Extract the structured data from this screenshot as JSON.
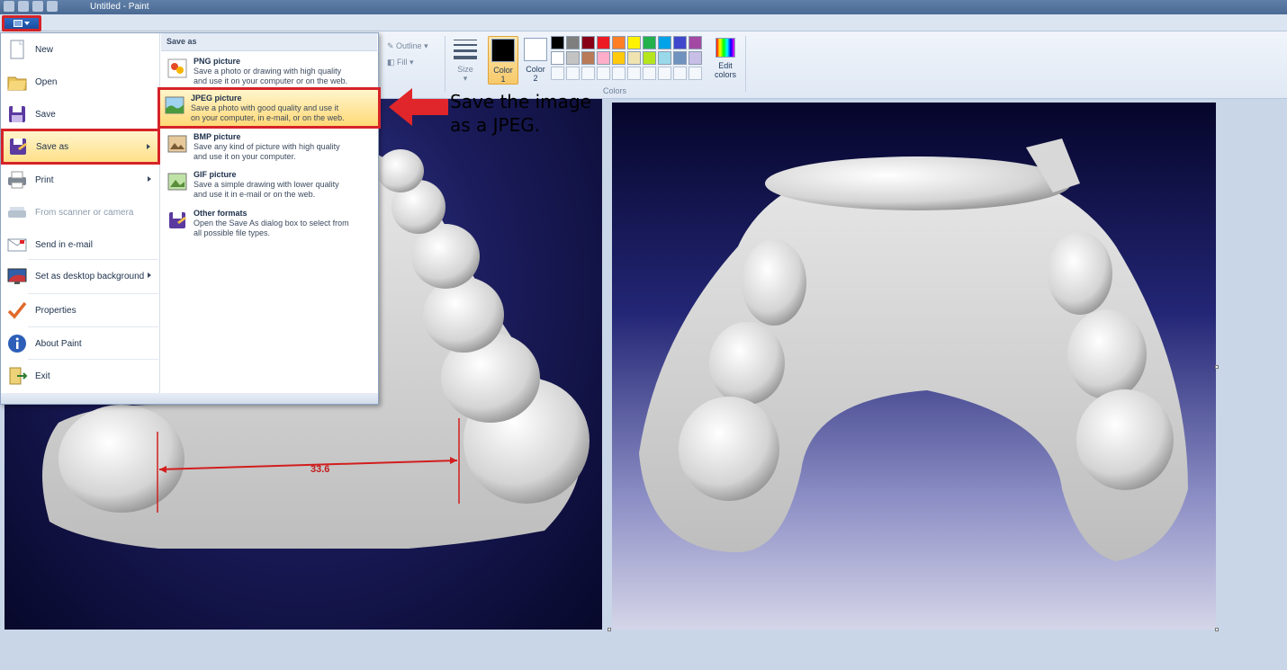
{
  "window": {
    "title": "Untitled - Paint"
  },
  "ribbon": {
    "outline_label": "Outline",
    "fill_label": "Fill",
    "size_label": "Size",
    "color1_label": [
      "Color",
      "1"
    ],
    "color2_label": [
      "Color",
      "2"
    ],
    "colors_group_label": "Colors",
    "edit_colors_label": [
      "Edit",
      "colors"
    ],
    "color1_value": "#000000",
    "color2_value": "#ffffff",
    "palette_row1": [
      "#000000",
      "#7f7f7f",
      "#880015",
      "#ed1c24",
      "#ff7f27",
      "#fff200",
      "#22b14c",
      "#00a2e8",
      "#3f48cc",
      "#a349a4"
    ],
    "palette_row2": [
      "#ffffff",
      "#c3c3c3",
      "#b97a57",
      "#ffaec9",
      "#ffc90e",
      "#efe4b0",
      "#b5e61d",
      "#99d9ea",
      "#7092be",
      "#c8bfe7"
    ]
  },
  "app_menu": {
    "items": [
      {
        "label": "New",
        "icon": "new-document-icon",
        "disabled": false
      },
      {
        "label": "Open",
        "icon": "open-folder-icon",
        "disabled": false
      },
      {
        "label": "Save",
        "icon": "floppy-disk-icon",
        "disabled": false
      },
      {
        "label": "Save as",
        "icon": "save-as-icon",
        "disabled": false,
        "submenu": true
      },
      {
        "label": "Print",
        "icon": "printer-icon",
        "disabled": false,
        "submenu": true
      },
      {
        "label": "From scanner or camera",
        "icon": "scanner-icon",
        "disabled": true
      },
      {
        "label": "Send in e-mail",
        "icon": "email-icon",
        "disabled": false
      },
      {
        "label": "Set as desktop background",
        "icon": "desktop-icon",
        "disabled": false,
        "submenu": true
      },
      {
        "label": "Properties",
        "icon": "checkmark-icon",
        "disabled": false
      },
      {
        "label": "About Paint",
        "icon": "info-icon",
        "disabled": false
      },
      {
        "label": "Exit",
        "icon": "exit-icon",
        "disabled": false
      }
    ],
    "submenu_title": "Save as",
    "submenu_items": [
      {
        "name": "PNG picture",
        "desc": [
          "Save a photo or drawing with high quality",
          "and use it on your computer or on the web."
        ]
      },
      {
        "name": "JPEG picture",
        "desc": [
          "Save a photo with good quality and use it",
          "on your computer, in e-mail, or on the web."
        ]
      },
      {
        "name": "BMP picture",
        "desc": [
          "Save any kind of picture with high quality",
          "and use it on your computer."
        ]
      },
      {
        "name": "GIF picture",
        "desc": [
          "Save a simple drawing with lower quality",
          "and use it in e-mail or on the web."
        ]
      },
      {
        "name": "Other formats",
        "desc": [
          "Open the Save As dialog box to select from",
          "all possible file types."
        ]
      }
    ]
  },
  "canvas": {
    "measurement": "33.6"
  },
  "annotation": {
    "lines": [
      "Save the image",
      "as a JPEG."
    ]
  }
}
